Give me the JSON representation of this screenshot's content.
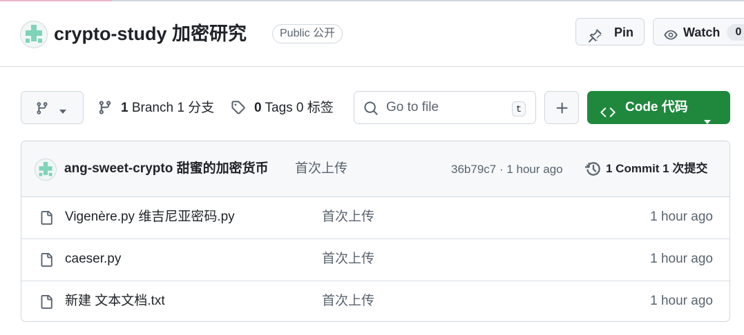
{
  "repo": {
    "name": "crypto-study 加密研究",
    "visibility": "Public 公开"
  },
  "header_actions": {
    "pin_label": "Pin",
    "watch_label": "Watch",
    "watch_count": "0"
  },
  "toolbar": {
    "branches_count": "1",
    "branches_label": "Branch 1 分支",
    "tags_count": "0",
    "tags_label": "Tags 0 标签",
    "search_placeholder": "Go to file",
    "search_shortcut": "t",
    "code_label": "Code 代码"
  },
  "latest_commit": {
    "author": "ang-sweet-crypto 甜蜜的加密货币",
    "message": "首次上传",
    "meta": "36b79c7 · 1 hour ago",
    "commits_label": "1 Commit 1 次提交"
  },
  "files": [
    {
      "name": "Vigenère.py 维吉尼亚密码.py",
      "message": "首次上传",
      "age": "1 hour ago",
      "icon": "file-icon"
    },
    {
      "name": "caeser.py",
      "message": "首次上传",
      "age": "1 hour ago",
      "icon": "file-icon"
    },
    {
      "name": "新建 文本文档.txt",
      "message": "首次上传",
      "age": "1 hour ago",
      "icon": "file-icon"
    }
  ],
  "colors": {
    "primary_button": "#1f883d",
    "border": "#d0d7de",
    "muted_text": "#59636e",
    "avatar_identicon": "#7fd3b8"
  }
}
